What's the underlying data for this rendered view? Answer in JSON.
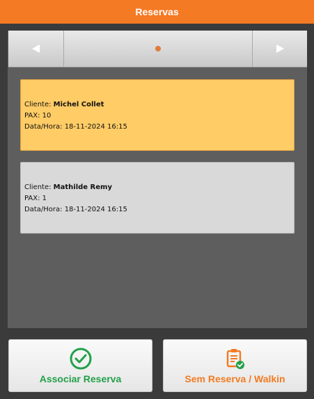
{
  "window": {
    "title": "Reservas"
  },
  "nav": {
    "prev_icon": "arrow-left-icon",
    "next_icon": "arrow-right-icon",
    "page_dot_color": "#e07a3a"
  },
  "reservations": [
    {
      "client_label": "Cliente:",
      "client": "Michel Collet",
      "pax_label": "PAX:",
      "pax": "10",
      "datetime_label": "Data/Hora:",
      "datetime": "18-11-2024 16:15",
      "selected": true
    },
    {
      "client_label": "Cliente:",
      "client": "Mathilde Remy",
      "pax_label": "PAX:",
      "pax": "1",
      "datetime_label": "Data/Hora:",
      "datetime": "18-11-2024 16:15",
      "selected": false
    }
  ],
  "actions": {
    "associate_label": "Associar Reserva",
    "associate_icon": "check-circle-icon",
    "walkin_label": "Sem Reserva / Walkin",
    "walkin_icon": "clipboard-check-icon"
  },
  "colors": {
    "accent": "#f57a24",
    "selected_card": "#ffcc66",
    "green": "#22a049",
    "orange_text": "#f27b21"
  }
}
